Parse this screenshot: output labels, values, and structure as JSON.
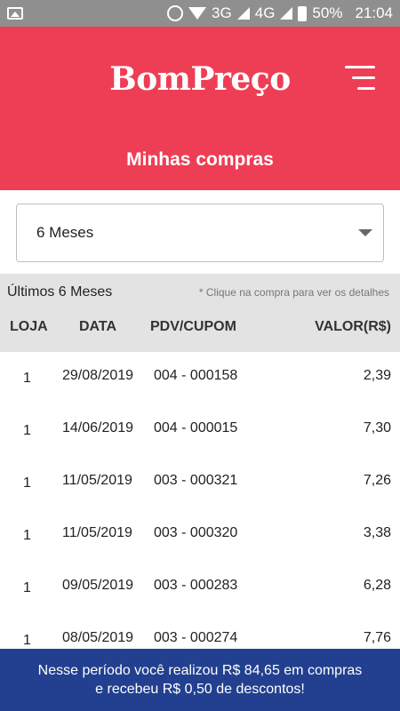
{
  "status_bar": {
    "network_1": "3G",
    "network_2": "4G",
    "battery": "50%",
    "time": "21:04",
    "icons": [
      "image-icon",
      "alarm-icon",
      "wifi-icon",
      "signal-icon",
      "battery-icon"
    ]
  },
  "header": {
    "logo": "BomPreço",
    "title": "Minhas compras",
    "menu_icon": "hamburger-menu-icon",
    "background": "#ee3e55"
  },
  "period_select": {
    "value": "6 Meses"
  },
  "table": {
    "period_label": "Últimos 6 Meses",
    "hint": "* Clique na compra para ver os detalhes",
    "columns": [
      "LOJA",
      "DATA",
      "PDV/CUPOM",
      "VALOR(R$)"
    ],
    "rows": [
      {
        "loja": "1",
        "data": "29/08/2019",
        "cupom": "004 - 000158",
        "valor": "2,39"
      },
      {
        "loja": "1",
        "data": "14/06/2019",
        "cupom": "004 - 000015",
        "valor": "7,30"
      },
      {
        "loja": "1",
        "data": "11/05/2019",
        "cupom": "003 - 000321",
        "valor": "7,26"
      },
      {
        "loja": "1",
        "data": "11/05/2019",
        "cupom": "003 - 000320",
        "valor": "3,38"
      },
      {
        "loja": "1",
        "data": "09/05/2019",
        "cupom": "003 - 000283",
        "valor": "6,28"
      },
      {
        "loja": "1",
        "data": "08/05/2019",
        "cupom": "003 - 000274",
        "valor": "7,76"
      }
    ]
  },
  "footer": {
    "line1": "Nesse período você realizou R$ 84,65 em compras",
    "line2": "e recebeu R$ 0,50 de descontos!",
    "background": "#22408f"
  }
}
